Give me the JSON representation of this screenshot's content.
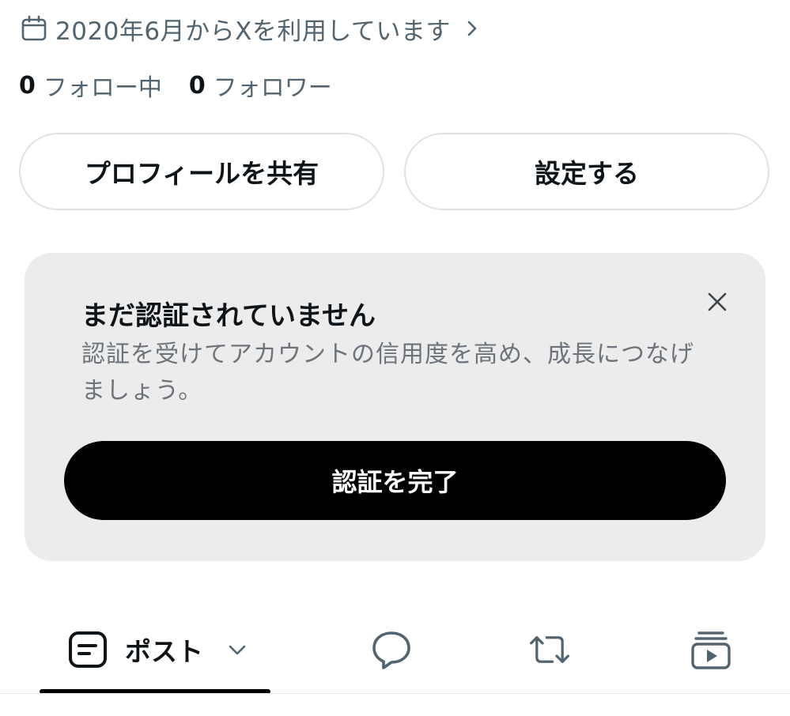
{
  "profile": {
    "joined_text": "2020年6月からXを利用しています",
    "following_count": "0",
    "following_label": "フォロー中",
    "followers_count": "0",
    "followers_label": "フォロワー"
  },
  "actions": {
    "share_label": "プロフィールを共有",
    "setup_label": "設定する"
  },
  "verify_card": {
    "title": "まだ認証されていません",
    "description": "認証を受けてアカウントの信用度を高め、成長につなげましょう。",
    "cta_label": "認証を完了"
  },
  "tabs": {
    "posts_label": "ポスト"
  },
  "icons": {
    "joined": "calendar-icon",
    "joined_more": "chevron-right-icon",
    "close": "close-icon",
    "posts": "posts-icon",
    "posts_menu": "chevron-down-icon",
    "replies": "speech-bubble-icon",
    "reposts": "repost-icon",
    "videos": "video-stack-icon"
  },
  "colors": {
    "text_primary": "#0f1419",
    "text_secondary": "#536471",
    "card_bg": "#ececec",
    "cta_bg": "#000000"
  }
}
